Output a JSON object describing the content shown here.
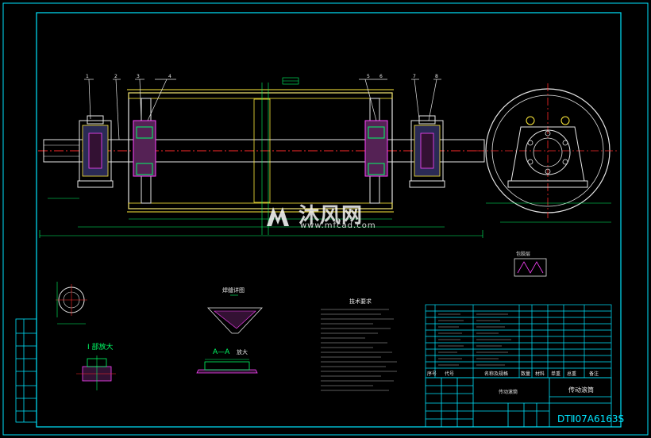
{
  "drawing": {
    "code": "DTⅡ07A6163S",
    "part_name": "传动滚筒",
    "colors": {
      "frame": "#00e5ff",
      "geometry": "#e6e6e6",
      "accent": "#ffeb3b",
      "center": "#ff2a2a",
      "dim": "#00ff66",
      "hatch": "#ff44ff",
      "bg": "#000000"
    }
  },
  "balloons": [
    "1",
    "2",
    "3",
    "4",
    "5",
    "6",
    "7",
    "8"
  ],
  "views": {
    "detail_I": "I 部放大",
    "section_AA": "A—A",
    "section_scale": "放大",
    "weld_detail": "焊缝详图",
    "lining_label": "包胶层"
  },
  "tech_requirements": {
    "title": "技术要求"
  },
  "sidebar_cells": [
    "借通用件登记",
    "描图",
    "描校",
    "旧底图总号",
    "签字",
    "日期"
  ],
  "bom_header": [
    "序号",
    "代号",
    "名称及规格",
    "数量",
    "材料",
    "单重",
    "总重",
    "备注"
  ],
  "title_block": {
    "part_name": "传动滚筒",
    "code": "DTⅡ07A6163S"
  },
  "watermark": {
    "text": "沐风网",
    "url": "www.mfcad.com"
  }
}
